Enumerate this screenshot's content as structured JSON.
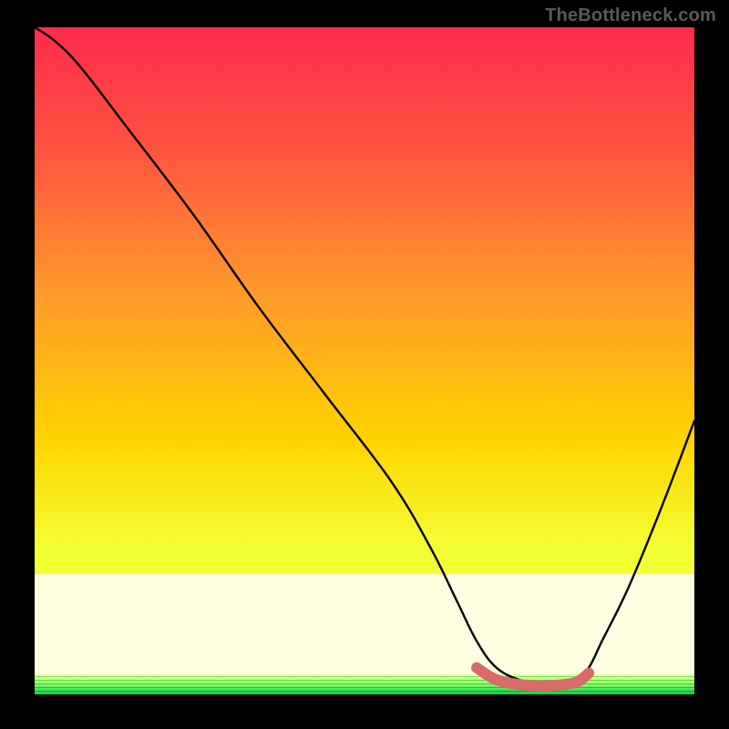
{
  "attribution": "TheBottleneck.com",
  "chart_data": {
    "type": "line",
    "title": "",
    "xlabel": "",
    "ylabel": "",
    "xlim": [
      0,
      100
    ],
    "ylim": [
      0,
      100
    ],
    "grid": false,
    "legend": false,
    "background": {
      "gradient_top": "#ff2a4d",
      "gradient_mid": "#ffd400",
      "gradient_bottom": "#00e756",
      "white_band_top_fraction": 0.82,
      "white_band_bottom_fraction": 0.97
    },
    "series": [
      {
        "name": "bottleneck-curve",
        "color": "#000000",
        "x": [
          0,
          3,
          7,
          14,
          24,
          34,
          44,
          54,
          60,
          64,
          67,
          70,
          74,
          78,
          82,
          84,
          86,
          90,
          95,
          100
        ],
        "values": [
          100,
          98,
          94,
          85,
          72,
          58,
          45,
          32,
          22,
          14,
          8,
          4,
          2,
          1.5,
          2,
          4,
          8,
          16,
          28,
          41
        ]
      },
      {
        "name": "optimal-band",
        "color": "#d86a6a",
        "style": "thick-segment",
        "x": [
          67,
          70,
          74,
          78,
          82,
          84
        ],
        "values": [
          4,
          2.2,
          1.4,
          1.3,
          1.8,
          3.2
        ]
      }
    ],
    "annotations": []
  }
}
